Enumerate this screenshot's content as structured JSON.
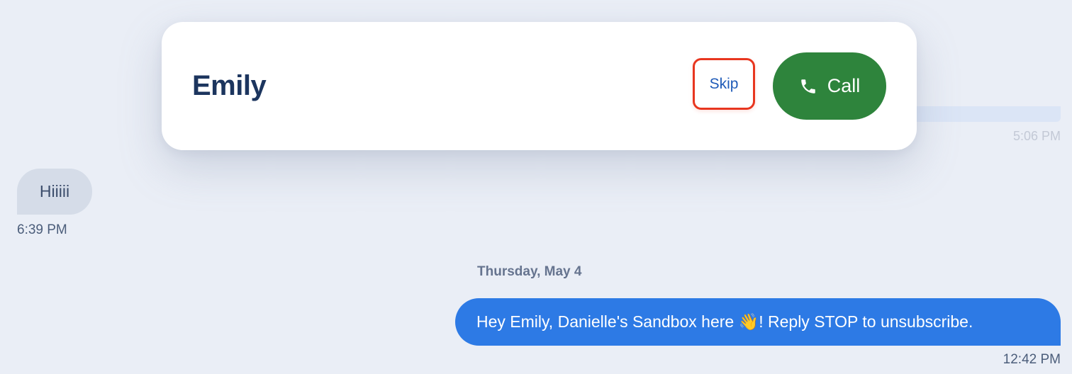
{
  "contact": {
    "name": "Emily",
    "skip_label": "Skip",
    "call_label": "Call"
  },
  "messages": {
    "earlier_time": "5:06 PM",
    "incoming": {
      "text": "Hiiiii",
      "time": "6:39 PM"
    },
    "date_separator": "Thursday, May 4",
    "outgoing": {
      "text": "Hey Emily, Danielle's Sandbox here 👋! Reply STOP to unsubscribe.",
      "time": "12:42 PM"
    }
  },
  "icons": {
    "call": "phone-icon"
  },
  "colors": {
    "background": "#eaeef6",
    "call_button": "#2e843c",
    "skip_highlight": "#e8361f",
    "outgoing_bubble": "#2d7ae5",
    "incoming_bubble": "#d5dce8",
    "contact_name": "#1c355e"
  }
}
